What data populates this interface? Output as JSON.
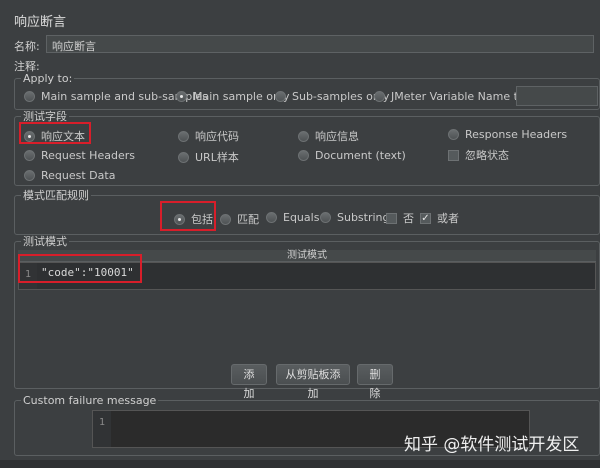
{
  "title": "响应断言",
  "name_label": "名称:",
  "name_value": "响应断言",
  "comment_label": "注释:",
  "comment_value": "",
  "apply_to": {
    "legend": "Apply to:",
    "options": [
      "Main sample and sub-samples",
      "Main sample only",
      "Sub-samples only",
      "JMeter Variable Name to use"
    ],
    "selected": "Main sample only",
    "variable_value": ""
  },
  "test_field": {
    "legend": "测试字段",
    "options": [
      "响应文本",
      "响应代码",
      "响应信息",
      "Response Headers",
      "Request Headers",
      "URL样本",
      "Document (text)",
      "Request Data"
    ],
    "selected": "响应文本",
    "ignore_status_label": "忽略状态",
    "ignore_status_checked": false
  },
  "pattern_rules": {
    "legend": "模式匹配规则",
    "options": [
      "包括",
      "匹配",
      "Equals",
      "Substring"
    ],
    "selected": "包括",
    "not_label": "否",
    "not_checked": false,
    "or_label": "或者",
    "or_checked": true
  },
  "patterns": {
    "legend": "测试模式",
    "column_header": "测试模式",
    "rows": [
      {
        "line": "1",
        "text": "\"code\":\"10001\""
      }
    ]
  },
  "buttons": {
    "add": "添加",
    "add_clipboard": "从剪贴板添加",
    "delete": "删除"
  },
  "failure": {
    "legend": "Custom failure message",
    "line": "1",
    "text": ""
  },
  "watermark": "知乎 @软件测试开发区"
}
